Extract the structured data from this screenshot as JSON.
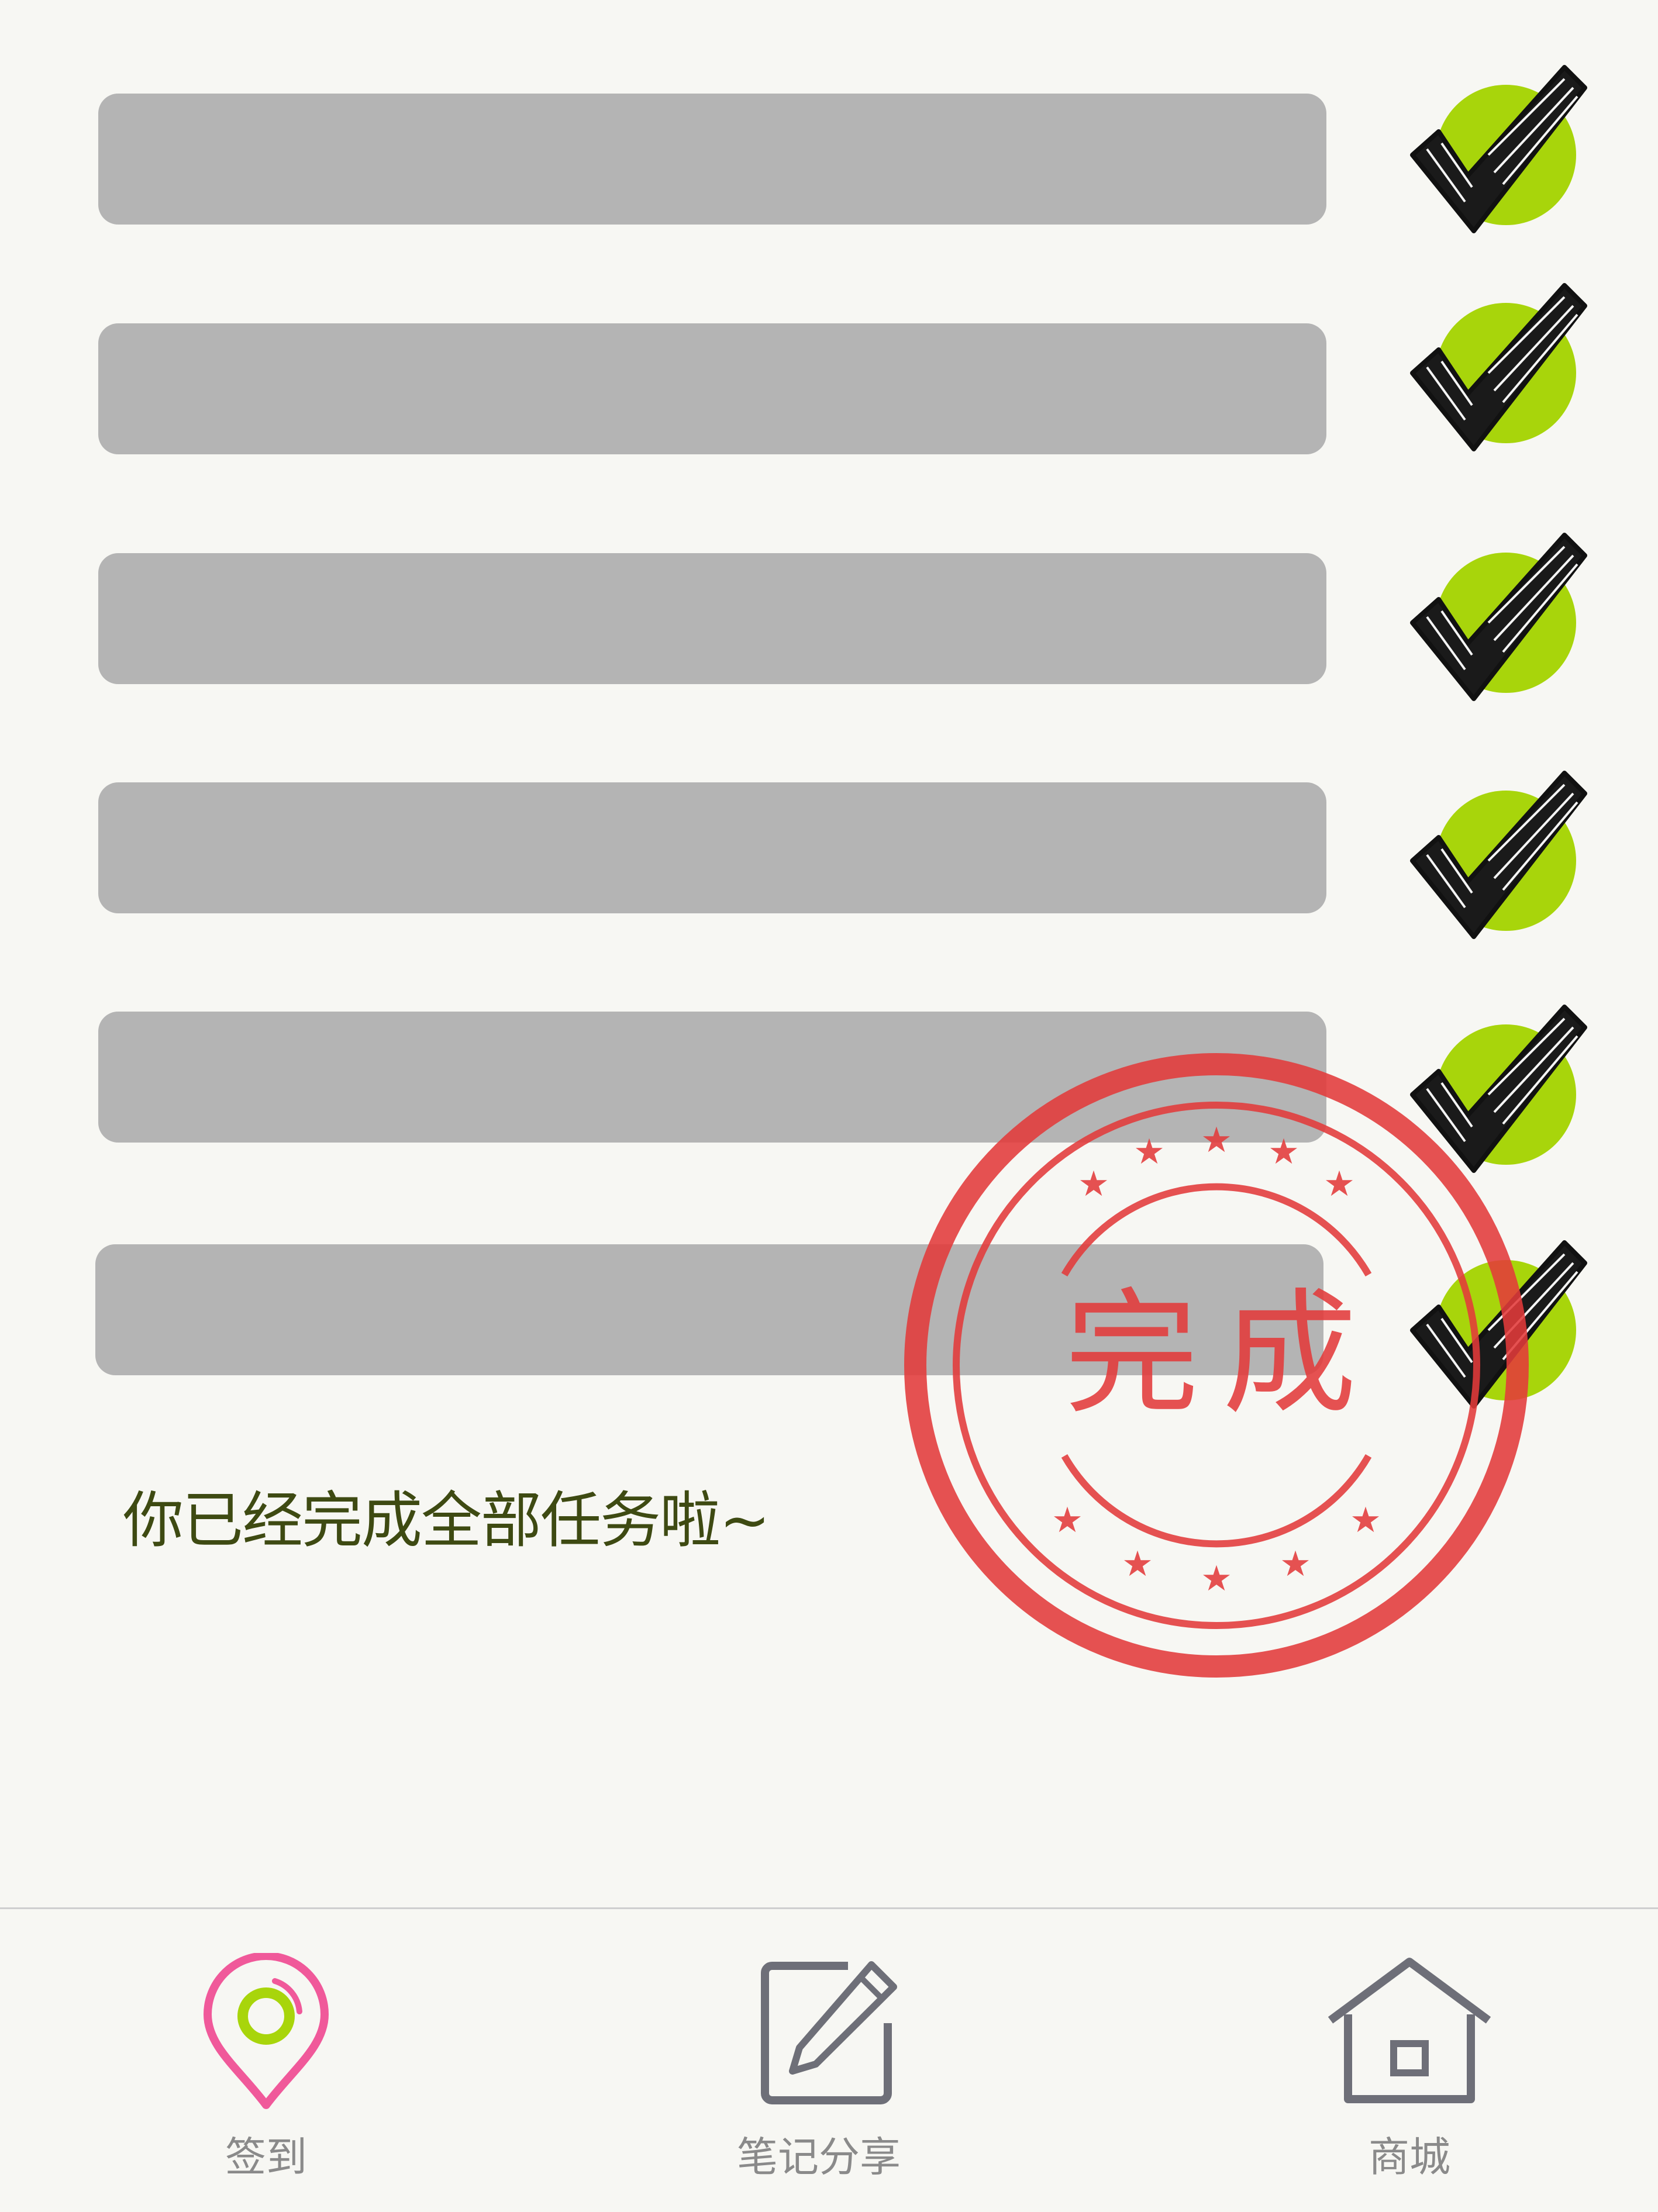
{
  "tasks": [
    {
      "completed": true
    },
    {
      "completed": true
    },
    {
      "completed": true
    },
    {
      "completed": true
    },
    {
      "completed": true
    },
    {
      "completed": true
    }
  ],
  "message": "你已经完成全部任务啦~",
  "stamp": {
    "text": "完成"
  },
  "nav": {
    "items": [
      {
        "label": "签到",
        "icon": "location-pin-icon",
        "active": true
      },
      {
        "label": "笔记分享",
        "icon": "edit-note-icon",
        "active": false
      },
      {
        "label": "商城",
        "icon": "home-icon",
        "active": false
      }
    ]
  },
  "colors": {
    "background": "#f7f7f3",
    "task_bar": "#b4b4b4",
    "check_circle": "#a8d50b",
    "message_text": "#3e4a12",
    "stamp": "#e23a3a",
    "nav_active_pink": "#f0599a",
    "nav_active_green": "#a8d50b",
    "nav_inactive": "#6e6f78"
  }
}
